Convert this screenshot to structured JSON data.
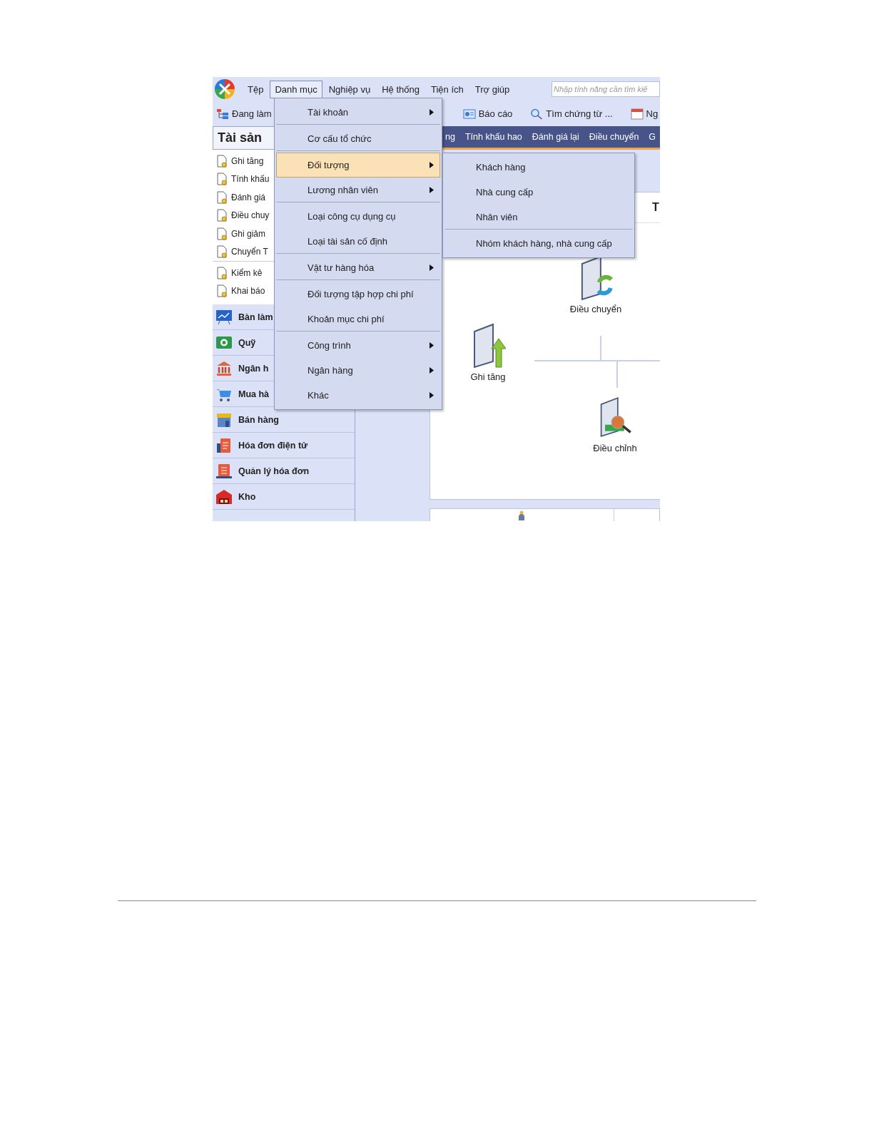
{
  "menubar": {
    "items": [
      {
        "label": "Tệp",
        "selected": false
      },
      {
        "label": "Danh mục",
        "selected": true
      },
      {
        "label": "Nghiệp vụ",
        "selected": false
      },
      {
        "label": "Hệ thống",
        "selected": false
      },
      {
        "label": "Tiện ích",
        "selected": false
      },
      {
        "label": "Trợ giúp",
        "selected": false
      }
    ],
    "search": {
      "placeholder": "Nhập tính năng cần tìm kiế"
    }
  },
  "toolbar": [
    "Đang làm",
    "Báo cáo",
    "Tìm chứng từ ...",
    "Ng"
  ],
  "left_panel": {
    "title": "Tài sản",
    "tasks": [
      {
        "label": "Ghi tăng",
        "divider_after": false
      },
      {
        "label": "Tính khấu",
        "divider_after": false
      },
      {
        "label": "Đánh giá",
        "divider_after": false
      },
      {
        "label": "Điều chuy",
        "divider_after": false
      },
      {
        "label": "Ghi giảm",
        "divider_after": false
      },
      {
        "label": "Chuyển T",
        "divider_after": true
      },
      {
        "label": "Kiểm kê",
        "divider_after": false
      },
      {
        "label": "Khai báo",
        "divider_after": false
      }
    ],
    "modules": [
      "Bàn làm",
      "Quỹ",
      "Ngân h",
      "Mua hà",
      "Bán hàng",
      "Hóa đơn điện tử",
      "Quản lý hóa đơn",
      "Kho"
    ]
  },
  "tabs": [
    "ng",
    "Tính khấu hao",
    "Đánh giá lại",
    "Điều chuyển",
    "G"
  ],
  "diagram": {
    "heading": "T",
    "nodes": [
      "Điều chuyển",
      "Ghi tăng",
      "Điều chỉnh"
    ]
  },
  "menu": {
    "items": [
      {
        "label": "Tài khoản",
        "has_submenu": true,
        "selected": false,
        "divider_after": true
      },
      {
        "label": "Cơ cấu tổ chức",
        "has_submenu": false,
        "selected": false,
        "divider_after": true
      },
      {
        "label": "Đối tượng",
        "has_submenu": true,
        "selected": true,
        "divider_after": false
      },
      {
        "label": "Lương nhân viên",
        "has_submenu": true,
        "selected": false,
        "divider_after": true
      },
      {
        "label": "Loại công cụ dụng cụ",
        "has_submenu": false,
        "selected": false,
        "divider_after": false
      },
      {
        "label": "Loại tài sản cố định",
        "has_submenu": false,
        "selected": false,
        "divider_after": true
      },
      {
        "label": "Vật tư hàng hóa",
        "has_submenu": true,
        "selected": false,
        "divider_after": true
      },
      {
        "label": "Đối tượng tập hợp chi phí",
        "has_submenu": false,
        "selected": false,
        "divider_after": false
      },
      {
        "label": "Khoản mục chi phí",
        "has_submenu": false,
        "selected": false,
        "divider_after": true
      },
      {
        "label": "Công trình",
        "has_submenu": true,
        "selected": false,
        "divider_after": false
      },
      {
        "label": "Ngân hàng",
        "has_submenu": true,
        "selected": false,
        "divider_after": false
      },
      {
        "label": "Khác",
        "has_submenu": true,
        "selected": false,
        "divider_after": false
      }
    ]
  },
  "submenu": {
    "items": [
      {
        "label": "Khách hàng",
        "divider_after": false
      },
      {
        "label": "Nhà cung cấp",
        "divider_after": false
      },
      {
        "label": "Nhân viên",
        "divider_after": true
      },
      {
        "label": "Nhóm khách hàng, nhà cung cấp",
        "divider_after": false
      }
    ]
  }
}
